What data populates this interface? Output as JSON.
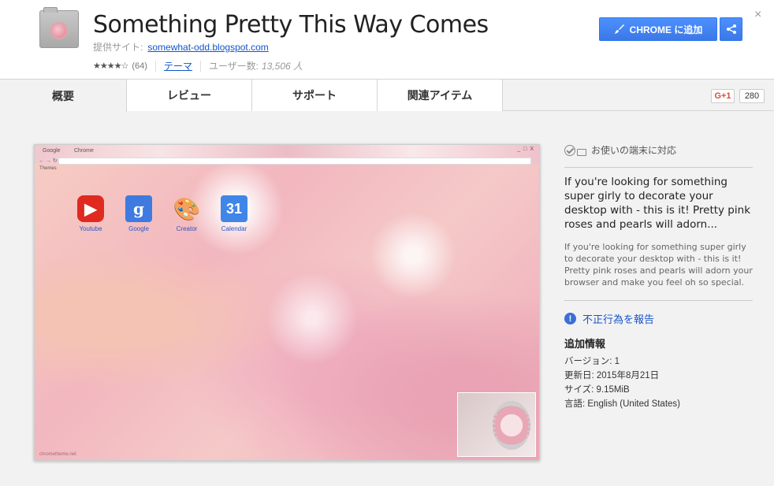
{
  "header": {
    "title": "Something Pretty This Way Comes",
    "offered_by_label": "提供サイト:",
    "offered_by_link": "somewhat-odd.blogspot.com",
    "stars": "★★★★☆",
    "rating_count": "(64)",
    "category": "テーマ",
    "users_label": "ユーザー数:",
    "users_value": "13,506 人",
    "add_button": "CHROME に追加",
    "close": "×"
  },
  "tabs": [
    {
      "label": "概要"
    },
    {
      "label": "レビュー"
    },
    {
      "label": "サポート"
    },
    {
      "label": "関連アイテム"
    }
  ],
  "social": {
    "gplus": "G+1",
    "count": "280"
  },
  "preview": {
    "tab1": "Google",
    "tab2": "Chrome",
    "window_controls": "_ □ X",
    "nav": "← → ↻",
    "bookmark": "Themes",
    "apps": [
      {
        "label": "Youtube",
        "icon": "youtube-icon",
        "glyph": "▶"
      },
      {
        "label": "Google",
        "icon": "google-icon",
        "glyph": "g"
      },
      {
        "label": "Creator",
        "icon": "palette-icon",
        "glyph": "🎨"
      },
      {
        "label": "Calendar",
        "icon": "calendar-icon",
        "glyph": "31"
      }
    ],
    "footer": "chrometheme.net"
  },
  "sidebar": {
    "compat": "お使いの端末に対応",
    "short_desc": "If you're looking for something super girly to decorate your desktop with - this is it! Pretty pink roses and pearls will adorn...",
    "long_desc": "If you're looking for something super girly to decorate your desktop with - this is it! Pretty pink roses and pearls will adorn your browser and make you feel oh so special.",
    "report": "不正行為を報告",
    "additional_title": "追加情報",
    "version": "バージョン: 1",
    "updated": "更新日: 2015年8月21日",
    "size": "サイズ: 9.15MiB",
    "language": "言語: English (United States)"
  },
  "colors": {
    "accent": "#4d90fe",
    "link": "#1155cc"
  }
}
